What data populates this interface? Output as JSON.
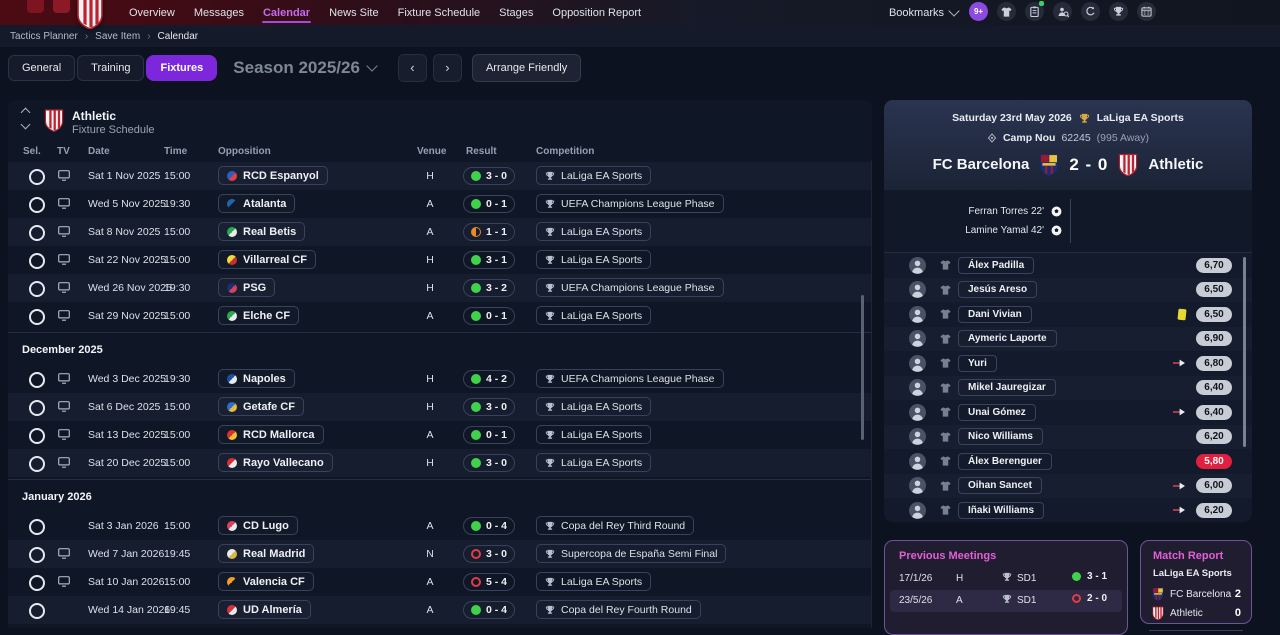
{
  "topnav": {
    "items": [
      "Overview",
      "Messages",
      "Calendar",
      "News Site",
      "Fixture Schedule",
      "Stages",
      "Opposition Report"
    ],
    "active_item": "Calendar",
    "bookmarks_label": "Bookmarks",
    "notification_badge": "9+"
  },
  "breadcrumb": {
    "items": [
      "Tactics Planner",
      "Save Item",
      "Calendar"
    ]
  },
  "toolbar": {
    "tabs": [
      "General",
      "Training",
      "Fixtures"
    ],
    "active_tab": "Fixtures",
    "season_label": "Season 2025/26",
    "prev_icon": "‹",
    "next_icon": "›",
    "arrange_friendly_label": "Arrange Friendly"
  },
  "fixture_table": {
    "club_name": "Athletic",
    "subtitle": "Fixture Schedule",
    "columns": [
      "Sel.",
      "TV",
      "Date",
      "Time",
      "Opposition",
      "Venue",
      "Result",
      "Competition"
    ],
    "sections": [
      {
        "month": null,
        "first_row_shade": "light",
        "rows": [
          {
            "date": "Sat 1 Nov 2025",
            "time": "15:00",
            "opposition": "RCD Espanyol",
            "badge": [
              "#2a5cc8",
              "#e04040"
            ],
            "venue": "H",
            "result": "3 - 0",
            "outcome": "win",
            "competition": "LaLiga EA Sports",
            "tv": true
          },
          {
            "date": "Wed 5 Nov 2025",
            "time": "19:30",
            "opposition": "Atalanta",
            "badge": [
              "#1a66b0",
              "#111827"
            ],
            "venue": "A",
            "result": "0 - 1",
            "outcome": "win",
            "competition": "UEFA Champions League Phase",
            "tv": true
          },
          {
            "date": "Sat 8 Nov 2025",
            "time": "15:00",
            "opposition": "Real Betis",
            "badge": [
              "#26a84c",
              "#e8eaee"
            ],
            "venue": "A",
            "result": "1 - 1",
            "outcome": "draw",
            "competition": "LaLiga EA Sports",
            "tv": true
          },
          {
            "date": "Sat 22 Nov 2025",
            "time": "15:00",
            "opposition": "Villarreal CF",
            "badge": [
              "#f2d93c",
              "#c83030"
            ],
            "venue": "H",
            "result": "3 - 1",
            "outcome": "win",
            "competition": "LaLiga EA Sports",
            "tv": true
          },
          {
            "date": "Wed 26 Nov 2025",
            "time": "19:30",
            "opposition": "PSG",
            "badge": [
              "#18316e",
              "#d84060"
            ],
            "venue": "H",
            "result": "3 - 2",
            "outcome": "win",
            "competition": "UEFA Champions League Phase",
            "tv": true
          },
          {
            "date": "Sat 29 Nov 2025",
            "time": "15:00",
            "opposition": "Elche CF",
            "badge": [
              "#2aa84c",
              "#e8eaee"
            ],
            "venue": "A",
            "result": "0 - 1",
            "outcome": "win",
            "competition": "LaLiga EA Sports",
            "tv": true
          }
        ]
      },
      {
        "month": "December 2025",
        "first_row_shade": "dark",
        "rows": [
          {
            "date": "Wed 3 Dec 2025",
            "time": "19:30",
            "opposition": "Napoles",
            "badge": [
              "#1b4f9e",
              "#e8eaee"
            ],
            "venue": "H",
            "result": "4 - 2",
            "outcome": "win",
            "competition": "UEFA Champions League Phase",
            "tv": true
          },
          {
            "date": "Sat 6 Dec 2025",
            "time": "15:00",
            "opposition": "Getafe CF",
            "badge": [
              "#2a6fc8",
              "#e8b840"
            ],
            "venue": "H",
            "result": "3 - 0",
            "outcome": "win",
            "competition": "LaLiga EA Sports",
            "tv": true
          },
          {
            "date": "Sat 13 Dec 2025",
            "time": "15:00",
            "opposition": "RCD Mallorca",
            "badge": [
              "#d83030",
              "#f0c030"
            ],
            "venue": "A",
            "result": "0 - 1",
            "outcome": "win",
            "competition": "LaLiga EA Sports",
            "tv": true
          },
          {
            "date": "Sat 20 Dec 2025",
            "time": "15:00",
            "opposition": "Rayo Vallecano",
            "badge": [
              "#d83030",
              "#e8eaee"
            ],
            "venue": "H",
            "result": "3 - 0",
            "outcome": "win",
            "competition": "LaLiga EA Sports",
            "tv": true
          }
        ]
      },
      {
        "month": "January 2026",
        "first_row_shade": "dark",
        "rows": [
          {
            "date": "Sat 3 Jan 2026",
            "time": "15:00",
            "opposition": "CD Lugo",
            "badge": [
              "#d84060",
              "#e8eaee"
            ],
            "venue": "A",
            "result": "0 - 4",
            "outcome": "win",
            "competition": "Copa del Rey Third Round",
            "tv": false
          },
          {
            "date": "Wed 7 Jan 2026",
            "time": "19:45",
            "opposition": "Real Madrid",
            "badge": [
              "#e8eaee",
              "#d8b84a"
            ],
            "venue": "N",
            "result": "3 - 0",
            "outcome": "loss",
            "competition": "Supercopa de España Semi Final",
            "tv": true
          },
          {
            "date": "Sat 10 Jan 2026",
            "time": "15:00",
            "opposition": "Valencia CF",
            "badge": [
              "#f0a028",
              "#16181f"
            ],
            "venue": "A",
            "result": "5 - 4",
            "outcome": "loss",
            "competition": "LaLiga EA Sports",
            "tv": true
          },
          {
            "date": "Wed 14 Jan 2026",
            "time": "19:45",
            "opposition": "UD Almería",
            "badge": [
              "#d83040",
              "#e8eaee"
            ],
            "venue": "A",
            "result": "0 - 4",
            "outcome": "win",
            "competition": "Copa del Rey Fourth Round",
            "tv": false
          }
        ]
      }
    ]
  },
  "match_panel": {
    "date": "Saturday 23rd May 2026",
    "competition": "LaLiga EA Sports",
    "venue": "Camp Nou",
    "attendance": "62245",
    "away_attendance": "(995 Away)",
    "home_team": "FC Barcelona",
    "away_team": "Athletic",
    "score": "2 - 0",
    "scorers": [
      "Ferran Torres 22'",
      "Lamine Yamal 42'"
    ],
    "ratings": [
      {
        "name": "Álex Padilla",
        "rating": "6,70"
      },
      {
        "name": "Jesús Areso",
        "rating": "6,50"
      },
      {
        "name": "Dani Vivian",
        "rating": "6,50",
        "yellow_card": true
      },
      {
        "name": "Aymeric Laporte",
        "rating": "6,90"
      },
      {
        "name": "Yuri",
        "rating": "6,80",
        "subbed": true
      },
      {
        "name": "Mikel Jauregizar",
        "rating": "6,40"
      },
      {
        "name": "Unai Gómez",
        "rating": "6,40",
        "subbed": true
      },
      {
        "name": "Nico Williams",
        "rating": "6,20"
      },
      {
        "name": "Álex Berenguer",
        "rating": "5,80",
        "low": true
      },
      {
        "name": "Oihan Sancet",
        "rating": "6,00",
        "subbed": true
      },
      {
        "name": "Iñaki Williams",
        "rating": "6,20",
        "subbed": true
      }
    ]
  },
  "previous_meetings": {
    "title": "Previous Meetings",
    "rows": [
      {
        "date": "17/1/26",
        "venue": "H",
        "competition": "SD1",
        "result": "3 - 1",
        "outcome": "win",
        "highlight": false
      },
      {
        "date": "23/5/26",
        "venue": "A",
        "competition": "SD1",
        "result": "2 - 0",
        "outcome": "loss",
        "highlight": true
      }
    ]
  },
  "match_report": {
    "title": "Match Report",
    "competition": "LaLiga EA Sports",
    "rows": [
      {
        "team": "FC Barcelona",
        "score": "2"
      },
      {
        "team": "Athletic",
        "score": "0"
      }
    ]
  },
  "colors": {
    "accent_purple": "#7d27dd",
    "active_nav_pink": "#c66bee",
    "panel_heading_pink": "#e25fd6",
    "win_green": "#41d24b",
    "draw_orange": "#e8892a",
    "loss_red": "#e23b47",
    "rating_low_bg": "#e0203e"
  }
}
